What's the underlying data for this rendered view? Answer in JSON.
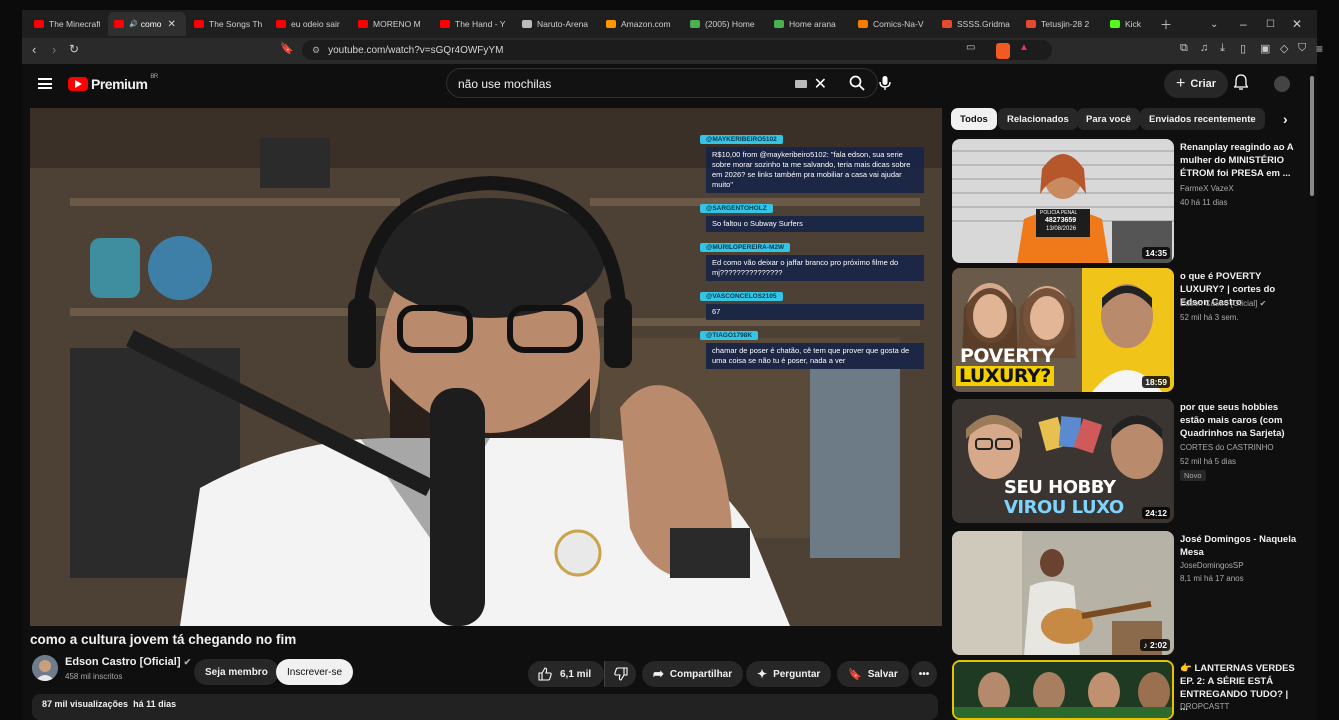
{
  "browser": {
    "tabs": [
      {
        "label": "The Minecraft",
        "color": "#ff0000"
      },
      {
        "label": "como",
        "color": "#ff0000",
        "active": true
      },
      {
        "label": "The Songs Th",
        "color": "#ff0000"
      },
      {
        "label": "eu odeio sair",
        "color": "#ff0000"
      },
      {
        "label": "MORENO M",
        "color": "#ff0000"
      },
      {
        "label": "The Hand - Y",
        "color": "#ff0000"
      },
      {
        "label": "Naruto-Arena",
        "color": "#bbbbbb"
      },
      {
        "label": "Amazon.com",
        "color": "#ff9900"
      },
      {
        "label": "(2005) Home",
        "color": "#4caf50"
      },
      {
        "label": "Home arana",
        "color": "#4caf50"
      },
      {
        "label": "Comics-Na-V",
        "color": "#f57c00"
      },
      {
        "label": "SSSS.Gridma",
        "color": "#e34a2f"
      },
      {
        "label": "Tetusjin-28 2",
        "color": "#e34a2f"
      },
      {
        "label": "Kick",
        "color": "#53fc18"
      }
    ],
    "url": "youtube.com/watch?v=sGQr4OWFyYM"
  },
  "youtube": {
    "logo_text": "Premium",
    "region": "BR",
    "search_query": "não use mochilas",
    "create_label": "Criar"
  },
  "video": {
    "title": "como a cultura jovem tá chegando no fim",
    "channel_name": "Edson Castro [Oficial]",
    "subscribers": "458 mil inscritos",
    "join_label": "Seja membro",
    "subscribe_label": "Inscrever-se",
    "likes": "6,1 mil",
    "share_label": "Compartilhar",
    "ask_label": "Perguntar",
    "save_label": "Salvar",
    "views": "87 mil visualizações",
    "age": "há 11 dias",
    "chat": [
      {
        "user": "@MAYKERIBEIRO5102",
        "msg": "R$10,00 from @maykeribeiro5102: \"fala edson, sua serie sobre morar sozinho ta me salvando, teria mais dicas sobre em 2026? se links também pra mobiliar a casa vai ajudar muito\""
      },
      {
        "user": "@SARGENTOHOLZ",
        "msg": "So faltou o Subway Surfers"
      },
      {
        "user": "@MURILOPEREIRA-M2W",
        "msg": "Ed como vão deixar o jaffar branco pro próximo filme do mj???????????????"
      },
      {
        "user": "@VASCONCELOS2105",
        "msg": "67"
      },
      {
        "user": "@TIAGO1798K",
        "msg": "chamar de poser é chatão, cê tem que prover que gosta de uma coisa se não tu é poser, nada a ver"
      }
    ]
  },
  "filters": [
    "Todos",
    "Relacionados",
    "Para você",
    "Enviados recentemente"
  ],
  "recommended": [
    {
      "title": "Renanplay reagindo ao  A mulher do MINISTÉRIO ÉTROM foi PRESA em ...",
      "channel": "FarmeX VazeX",
      "meta": "40  há 11 dias",
      "duration": "14:35"
    },
    {
      "title": "o que é POVERTY LUXURY? | cortes do Edson Castro",
      "channel": "Edson Castro [Oficial]",
      "meta": "52 mil  há 3 sem.",
      "duration": "18:59",
      "thumb_text": [
        "POVERTY",
        "LUXURY?"
      ]
    },
    {
      "title": "por que seus hobbies estão mais caros (com Quadrinhos na Sarjeta)",
      "channel": "CORTES do CASTRINHO",
      "meta": "52 mil  há 5 dias",
      "duration": "24:12",
      "badge": "Novo",
      "thumb_text": [
        "SEU HOBBY",
        "VIROU LUXO"
      ]
    },
    {
      "title": "José Domingos -  Naquela Mesa",
      "channel": "JoseDomingosSP",
      "meta": "8,1 mi  há 17 anos",
      "duration": "2:02"
    },
    {
      "title": "👉 LANTERNAS VERDES EP. 2: A SÉRIE ESTÁ ENTREGANDO TUDO? | ...",
      "channel": "DROPCASTT",
      "meta": "",
      "duration": ""
    }
  ],
  "mugshot": {
    "label": "POLICIA PENAL",
    "id": "48273659",
    "date": "13/08/2026"
  }
}
